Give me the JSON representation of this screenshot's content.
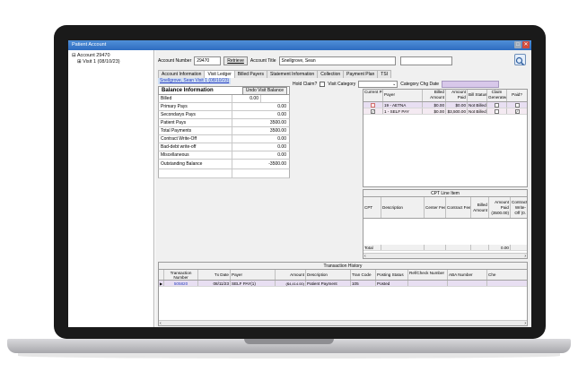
{
  "window": {
    "title": "Patient Account"
  },
  "tree": {
    "root": "Account 29470",
    "child": "Visit 1 (08/10/23)"
  },
  "account": {
    "number_label": "Account Number",
    "number_value": "29470",
    "retrieve_label": "Retrieve",
    "title_label": "Account Title",
    "title_value": "Snellgrove, Sean"
  },
  "tabs": [
    "Account Information",
    "Visit Ledger",
    "Billed Payers",
    "Statement Information",
    "Collection",
    "Payment Plan",
    "TSI"
  ],
  "balance": {
    "visit_link": "Snellgrove, Sean Visit 1 (08/10/23)",
    "heading": "Balance Information",
    "undo_label": "Undo Visit Balance",
    "billed_label": "Billed",
    "billed_value": "0.00",
    "rows": [
      {
        "label": "Primary Pays",
        "value": "0.00"
      },
      {
        "label": "Secondarys Pays",
        "value": "0.00"
      },
      {
        "label": "Patient Pays",
        "value": "3500.00"
      },
      {
        "label": "Total Payments",
        "value": "3500.00"
      },
      {
        "label": "Contract Write-Off",
        "value": "0.00"
      },
      {
        "label": "Bad-debt write-off",
        "value": "0.00"
      },
      {
        "label": "Miscellaneous",
        "value": "0.00"
      }
    ],
    "outstanding_label": "Outstanding Balance",
    "outstanding_value": "-3500.00"
  },
  "hold": {
    "hold_label": "Hold Claim?",
    "visit_category_label": "Visit Category",
    "category_date_label": "Category Chg Date"
  },
  "payers": {
    "headers": [
      "Current Payer",
      "Payer",
      "Billed Amount",
      "Amount Paid",
      "Bill Status",
      "Claim Generated?",
      "Paid?"
    ],
    "rows": [
      {
        "payer": "19 - AETNA",
        "billed": "$0.00",
        "paid": "$0.00",
        "status": "Not Billed"
      },
      {
        "payer": "1 - SELF PAY",
        "billed": "$0.00",
        "paid": "$3,500.00",
        "status": "Not Billed"
      }
    ]
  },
  "cpt": {
    "caption": "CPT Line Item",
    "headers": [
      "CPT",
      "Description",
      "Center Fee",
      "Contract Fee",
      "Billed Amount",
      "Amount Paid (3500.00)",
      "Contract Write-Off (0."
    ],
    "total_label": "Total",
    "total_value": "0.00"
  },
  "transactions": {
    "caption": "Transaction History",
    "headers": [
      "Transaction Number",
      "Tx Date",
      "Payer",
      "Amount",
      "Description",
      "Tran Code",
      "Posting Status",
      "Ref/Check Number",
      "ABA Number",
      "Che"
    ],
    "rows": [
      {
        "number": "505820",
        "date": "08/11/23",
        "payer": "SELF PAY(1)",
        "amount": "($4,414.00)",
        "description": "Patient Payment",
        "code": "105",
        "status": "Posted"
      }
    ]
  }
}
